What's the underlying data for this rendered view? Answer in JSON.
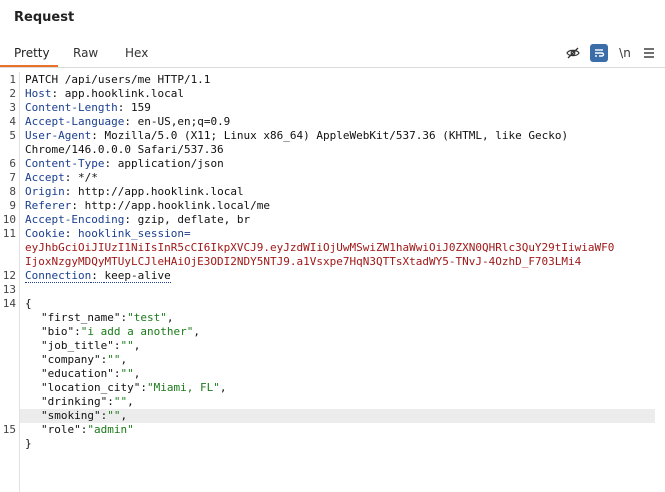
{
  "panel": {
    "title": "Request"
  },
  "tabs": [
    {
      "label": "Pretty",
      "active": true
    },
    {
      "label": "Raw",
      "active": false
    },
    {
      "label": "Hex",
      "active": false
    }
  ],
  "toolbar": {
    "icons": [
      "eye-off-icon",
      "wrap-lines-icon",
      "newline-icon",
      "menu-icon"
    ],
    "newline_label": "\\n",
    "active_color": "#3b6ea8"
  },
  "accent_color": "#e8722a",
  "request": {
    "line1": "PATCH /api/users/me HTTP/1.1",
    "headers": [
      {
        "name": "Host",
        "value": "app.hooklink.local"
      },
      {
        "name": "Content-Length",
        "value": "159"
      },
      {
        "name": "Accept-Language",
        "value": "en-US,en;q=0.9"
      },
      {
        "name": "User-Agent",
        "value": "Mozilla/5.0 (X11; Linux x86_64) AppleWebKit/537.36 (KHTML, like Gecko)"
      },
      {
        "name": "Content-Type",
        "value": "application/json"
      },
      {
        "name": "Accept",
        "value": "*/*"
      },
      {
        "name": "Origin",
        "value": "http://app.hooklink.local"
      },
      {
        "name": "Referer",
        "value": "http://app.hooklink.local/me"
      },
      {
        "name": "Accept-Encoding",
        "value": "gzip, deflate, br"
      },
      {
        "name": "Cookie",
        "value": "hooklink_session="
      },
      {
        "name": "Connection",
        "value": "keep-alive"
      }
    ],
    "user_agent_cont": "Chrome/146.0.0.0 Safari/537.36",
    "cookie_line1": "eyJhbGciOiJIUzI1NiIsInR5cCI6IkpXVCJ9.eyJzdWIiOjUwMSwiZW1haWwiOiJ0ZXN0QHRlc3QuY29tIiwiaWF0",
    "cookie_line2": "IjoxNzgyMDQyMTUyLCJleHAiOjE3ODI2NDY5NTJ9.a1Vsxpe7HqN3QTTsXtadWY5-TNvJ-4OzhD_F703LMi4",
    "body_open": "{",
    "body_close": "}",
    "body": [
      {
        "key": "\"first_name\"",
        "value": "\"test\""
      },
      {
        "key": "\"bio\"",
        "value": "\"i add a another\""
      },
      {
        "key": "\"job_title\"",
        "value": "\"\""
      },
      {
        "key": "\"company\"",
        "value": "\"\""
      },
      {
        "key": "\"education\"",
        "value": "\"\""
      },
      {
        "key": "\"location_city\"",
        "value": "\"Miami, FL\""
      },
      {
        "key": "\"drinking\"",
        "value": "\"\""
      },
      {
        "key": "\"smoking\"",
        "value": "\"\""
      },
      {
        "key": "\"role\"",
        "value": "\"admin\""
      }
    ],
    "line_numbers": [
      "1",
      "2",
      "3",
      "4",
      "5",
      "6",
      "7",
      "8",
      "9",
      "10",
      "11",
      "12",
      "13",
      "14",
      "15"
    ]
  }
}
